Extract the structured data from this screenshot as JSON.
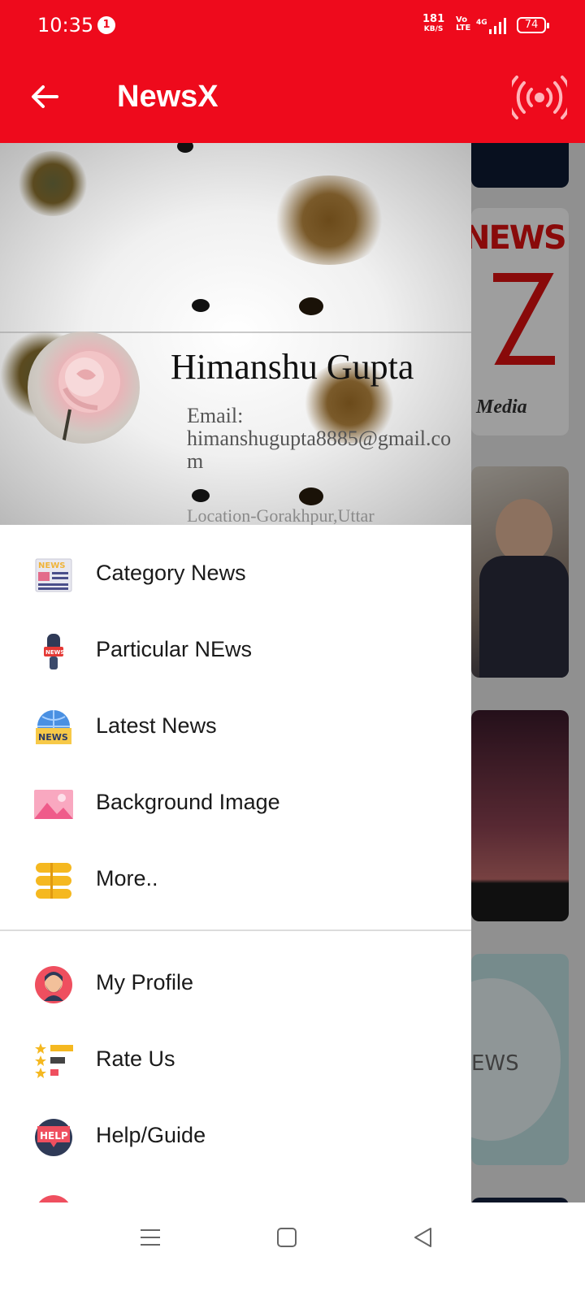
{
  "status_bar": {
    "time": "10:35",
    "notification_count": "1",
    "net_speed_value": "181",
    "net_speed_unit": "KB/S",
    "volte_line1": "Vo",
    "volte_line2": "LTE",
    "network": "4G",
    "battery": "74"
  },
  "app_bar": {
    "title": "NewsX",
    "back_icon": "arrow-left",
    "action_icon": "live-broadcast"
  },
  "background": {
    "card_2_text_1": "NEWS",
    "card_2_text_2": "Media",
    "card_5_text": "EWS"
  },
  "drawer": {
    "header": {
      "name": "Himanshu Gupta",
      "email_label": "Email:",
      "email": "himanshugupta8885@gmail.com",
      "location": "Location-Gorakhpur,Uttar"
    },
    "primary_items": [
      {
        "label": "Category News",
        "icon": "newspaper-icon"
      },
      {
        "label": "Particular NEws",
        "icon": "microphone-icon"
      },
      {
        "label": "Latest News",
        "icon": "globe-news-icon"
      },
      {
        "label": "Background Image",
        "icon": "image-icon"
      },
      {
        "label": "More..",
        "icon": "menu-stack-icon"
      }
    ],
    "secondary_items": [
      {
        "label": "My Profile",
        "icon": "profile-icon"
      },
      {
        "label": "Rate Us",
        "icon": "star-rating-icon"
      },
      {
        "label": "Help/Guide",
        "icon": "help-icon"
      }
    ]
  },
  "colors": {
    "primary": "#ee0a1c",
    "drawer_bg": "#ffffff",
    "text": "#1a1a1a"
  }
}
